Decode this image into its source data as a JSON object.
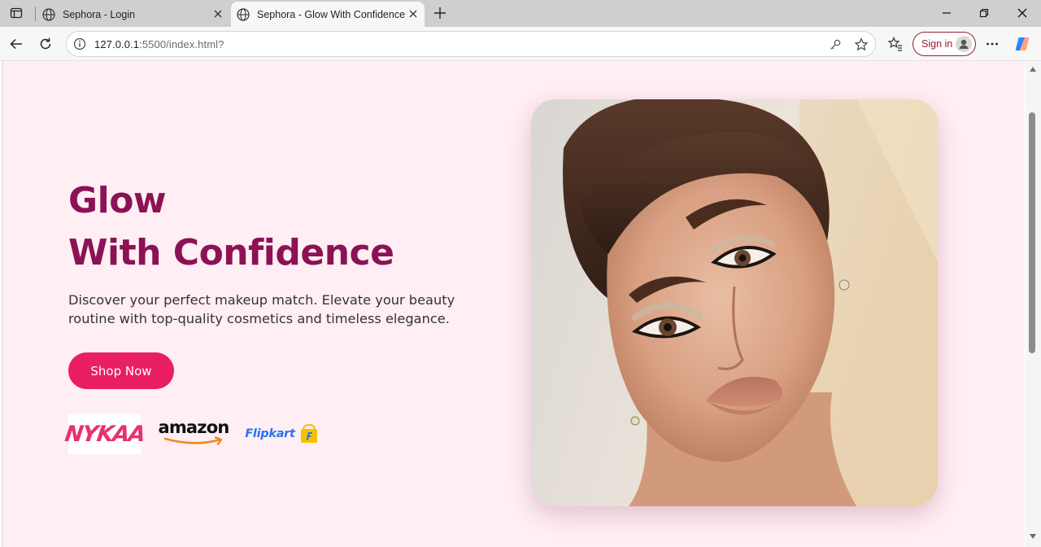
{
  "browser": {
    "tabs": [
      {
        "title": "Sephora - Login",
        "active": false
      },
      {
        "title": "Sephora - Glow With Confidence",
        "active": true
      }
    ],
    "url": {
      "host": "127.0.0.1",
      "rest": ":5500/index.html?"
    },
    "sign_in_label": "Sign in"
  },
  "hero": {
    "title_line1": "Glow",
    "title_line2": "With Confidence",
    "description": "Discover your perfect makeup match. Elevate your beauty routine with top-quality cosmetics and timeless elegance.",
    "cta_label": "Shop Now"
  },
  "brands": [
    {
      "name": "NYKAA"
    },
    {
      "name": "amazon"
    },
    {
      "name": "Flipkart"
    }
  ],
  "colors": {
    "accent": "#e91e63",
    "title": "#8b1254",
    "page_bg": "#ffeef3"
  },
  "icons": [
    "sidebar-icon",
    "globe-icon",
    "close-icon",
    "plus-icon",
    "minimize-icon",
    "restore-icon",
    "back-icon",
    "refresh-icon",
    "info-icon",
    "key-icon",
    "star-icon",
    "favorites-icon",
    "more-icon",
    "copilot-icon"
  ]
}
